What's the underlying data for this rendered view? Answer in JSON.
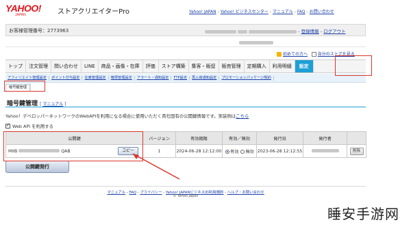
{
  "header": {
    "logo_main": "YAHOO!",
    "logo_sub": "JAPAN",
    "app_name": "ストアクリエイターPro",
    "links": [
      "Yahoo! JAPAN",
      "Yahoo! ビジネスセンター",
      "マニュアル",
      "FAQ",
      "お問い合わせ"
    ]
  },
  "account": {
    "label": "お客様管理番号：2773963",
    "logout": "ログアウト",
    "register": "登録情報"
  },
  "shortcuts": {
    "first_time": "初めての方へ",
    "view_store": "自分のストアを見る"
  },
  "mainnav": [
    "トップ",
    "注文管理",
    "問い合わせ",
    "LINE",
    "商品・画像・在庫",
    "評価",
    "ストア構築",
    "集客・販促",
    "販売管理",
    "定期購入",
    "利用明細",
    "設定"
  ],
  "subnav": [
    "アフィリエイト管理設定",
    "ポイント付与設定",
    "在庫管理設定",
    "権限管理設定",
    "アラート・通知設定",
    "FTP設定",
    "再入荷通知設定",
    "プロモーションパッケージ契約"
  ],
  "subnav_current": "暗号鍵管理",
  "page": {
    "title": "暗号鍵管理",
    "manual_label": "マニュアル",
    "description": "Yahoo！デベロッパーネットワークのWebAPIを利用になる場合に使用いただく貴社固有の公開鍵情報です。実装例は",
    "description_link": "こちら",
    "checkbox_label": "Web API を利用する"
  },
  "table": {
    "headers": [
      "公開鍵",
      "バージョン",
      "有効期限",
      "有効／無効",
      "発行日",
      "発行者",
      ""
    ],
    "row": {
      "key_prefix": "MIIB",
      "key_suffix": "QAB",
      "copy_label": "コピー",
      "version": "1",
      "expires": "2024-06-28 12:12:00",
      "status_on": "有効",
      "status_off": "無効",
      "issued": "2023-06-28 12:12:55",
      "delete_label": "削除"
    }
  },
  "issue_button": "公開鍵発行",
  "footer": {
    "links": [
      "マニュアル",
      "FAQ",
      "プライバシー",
      "Yahoo! JAPANビジネスID利用規約",
      "ヘルプ・お問い合わせ"
    ],
    "copyright": "© Yahoo Japan"
  },
  "watermark": "睡安手游网",
  "colors": {
    "accent": "#1e9fd6",
    "highlight": "#d9362c",
    "logo": "#e0161c",
    "link": "#1a3fa8"
  }
}
